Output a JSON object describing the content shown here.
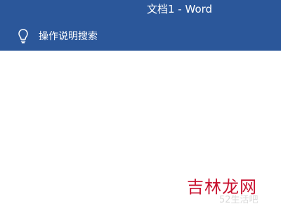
{
  "window": {
    "title": "文档1  -  Word"
  },
  "ribbon": {
    "tell_me": {
      "icon": "lightbulb-icon",
      "label": "操作说明搜索"
    }
  },
  "watermark": {
    "main_text": "吉林龙网",
    "sub_text": "52生活吧"
  },
  "colors": {
    "ribbon_bg": "#2b579a",
    "ribbon_text": "#ffffff",
    "watermark_red": "#c8102e",
    "watermark_gray": "#d9d9d9",
    "document_bg": "#ffffff"
  }
}
